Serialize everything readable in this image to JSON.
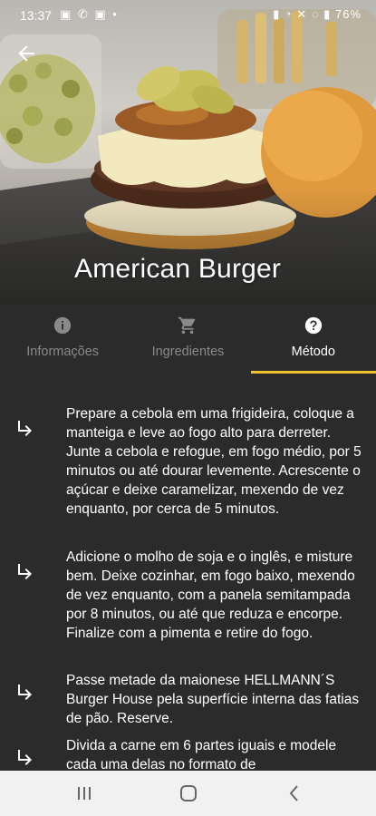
{
  "status": {
    "time": "13:37",
    "battery": "76%",
    "left_icons": "▣ ✆ ▣ •",
    "right_icons": "▮ ◔ ✕ ◌ ▮"
  },
  "recipe": {
    "title": "American Burger"
  },
  "tabs": [
    {
      "label": "Informações",
      "icon": "info-icon",
      "active": false
    },
    {
      "label": "Ingredientes",
      "icon": "cart-icon",
      "active": false
    },
    {
      "label": "Método",
      "icon": "help-icon",
      "active": true
    }
  ],
  "colors": {
    "accent": "#f3c22f",
    "background": "#2b2b2b",
    "inactive_tab": "#8a8a8a"
  },
  "steps": [
    {
      "text": "Prepare a cebola em uma frigideira, coloque a manteiga e leve ao fogo alto para derreter. Junte a cebola e refogue, em fogo médio, por 5 minutos ou até dourar levemente. Acrescente o açúcar e deixe caramelizar, mexendo de vez enquanto, por cerca de 5 minutos."
    },
    {
      "text": "Adicione o molho de soja e o inglês, e misture bem. Deixe cozinhar, em fogo baixo, mexendo de vez enquanto, com a panela semitampada por 8 minutos, ou até que reduza e encorpe. Finalize com a pimenta e retire do fogo."
    },
    {
      "text": "Passe metade da maionese HELLMANN´S Burger House pela superfície interna das fatias de pão. Reserve."
    },
    {
      "text": "Divida a carne em 6 partes iguais e modele cada uma delas no formato de"
    }
  ],
  "navbar": {
    "recents_icon": "recents-icon",
    "home_icon": "home-icon",
    "back_icon": "back-nav-icon"
  }
}
